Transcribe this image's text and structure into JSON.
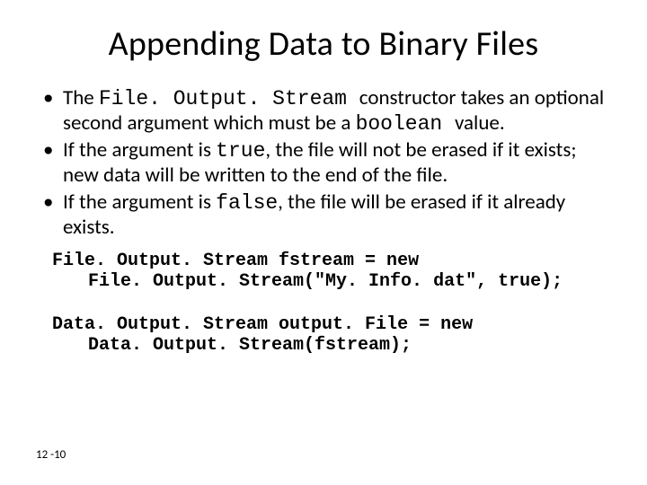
{
  "title": "Appending Data to Binary Files",
  "bullets": {
    "b1": {
      "t1": "The ",
      "c1": "File. Output. Stream ",
      "t2": "constructor takes an optional second argument which must be a ",
      "c2": "boolean ",
      "t3": "value."
    },
    "b2": {
      "t1": "If the argument is ",
      "c1": "true",
      "t2": ", the file will not be erased if it exists; new data will be written to the end of the file."
    },
    "b3": {
      "t1": "If the argument is ",
      "c1": "false",
      "t2": ", the file will be erased if it already exists."
    }
  },
  "code": {
    "l1": "File. Output. Stream fstream = new",
    "l2": "File. Output. Stream(\"My. Info. dat\", true);",
    "l3": "Data. Output. Stream output. File = new",
    "l4": "Data. Output. Stream(fstream);"
  },
  "page": "12 -10"
}
